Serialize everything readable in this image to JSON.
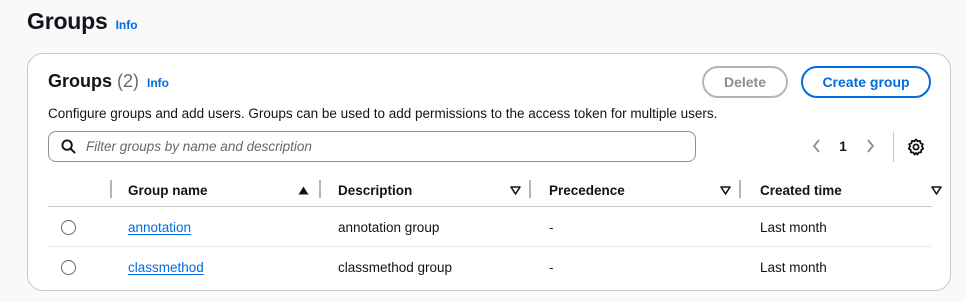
{
  "page": {
    "title": "Groups",
    "info_label": "Info"
  },
  "card": {
    "title": "Groups",
    "count": "(2)",
    "info_label": "Info",
    "description": "Configure groups and add users. Groups can be used to add permissions to the access token for multiple users.",
    "delete_label": "Delete",
    "create_label": "Create group"
  },
  "filter": {
    "placeholder": "Filter groups by name and description",
    "value": "",
    "icon": "search-icon"
  },
  "pagination": {
    "current_page": "1"
  },
  "table": {
    "columns": [
      {
        "label": "Group name",
        "sort": "ascending"
      },
      {
        "label": "Description",
        "sort": "none"
      },
      {
        "label": "Precedence",
        "sort": "none"
      },
      {
        "label": "Created time",
        "sort": "none"
      }
    ],
    "rows": [
      {
        "name": "annotation",
        "description": "annotation group",
        "precedence": "-",
        "created": "Last month",
        "selected": false
      },
      {
        "name": "classmethod",
        "description": "classmethod group",
        "precedence": "-",
        "created": "Last month",
        "selected": false
      }
    ]
  },
  "colors": {
    "accent": "#006ce0",
    "text": "#0f141a",
    "border": "#c6c6cd",
    "disabled": "#8c8c94"
  }
}
